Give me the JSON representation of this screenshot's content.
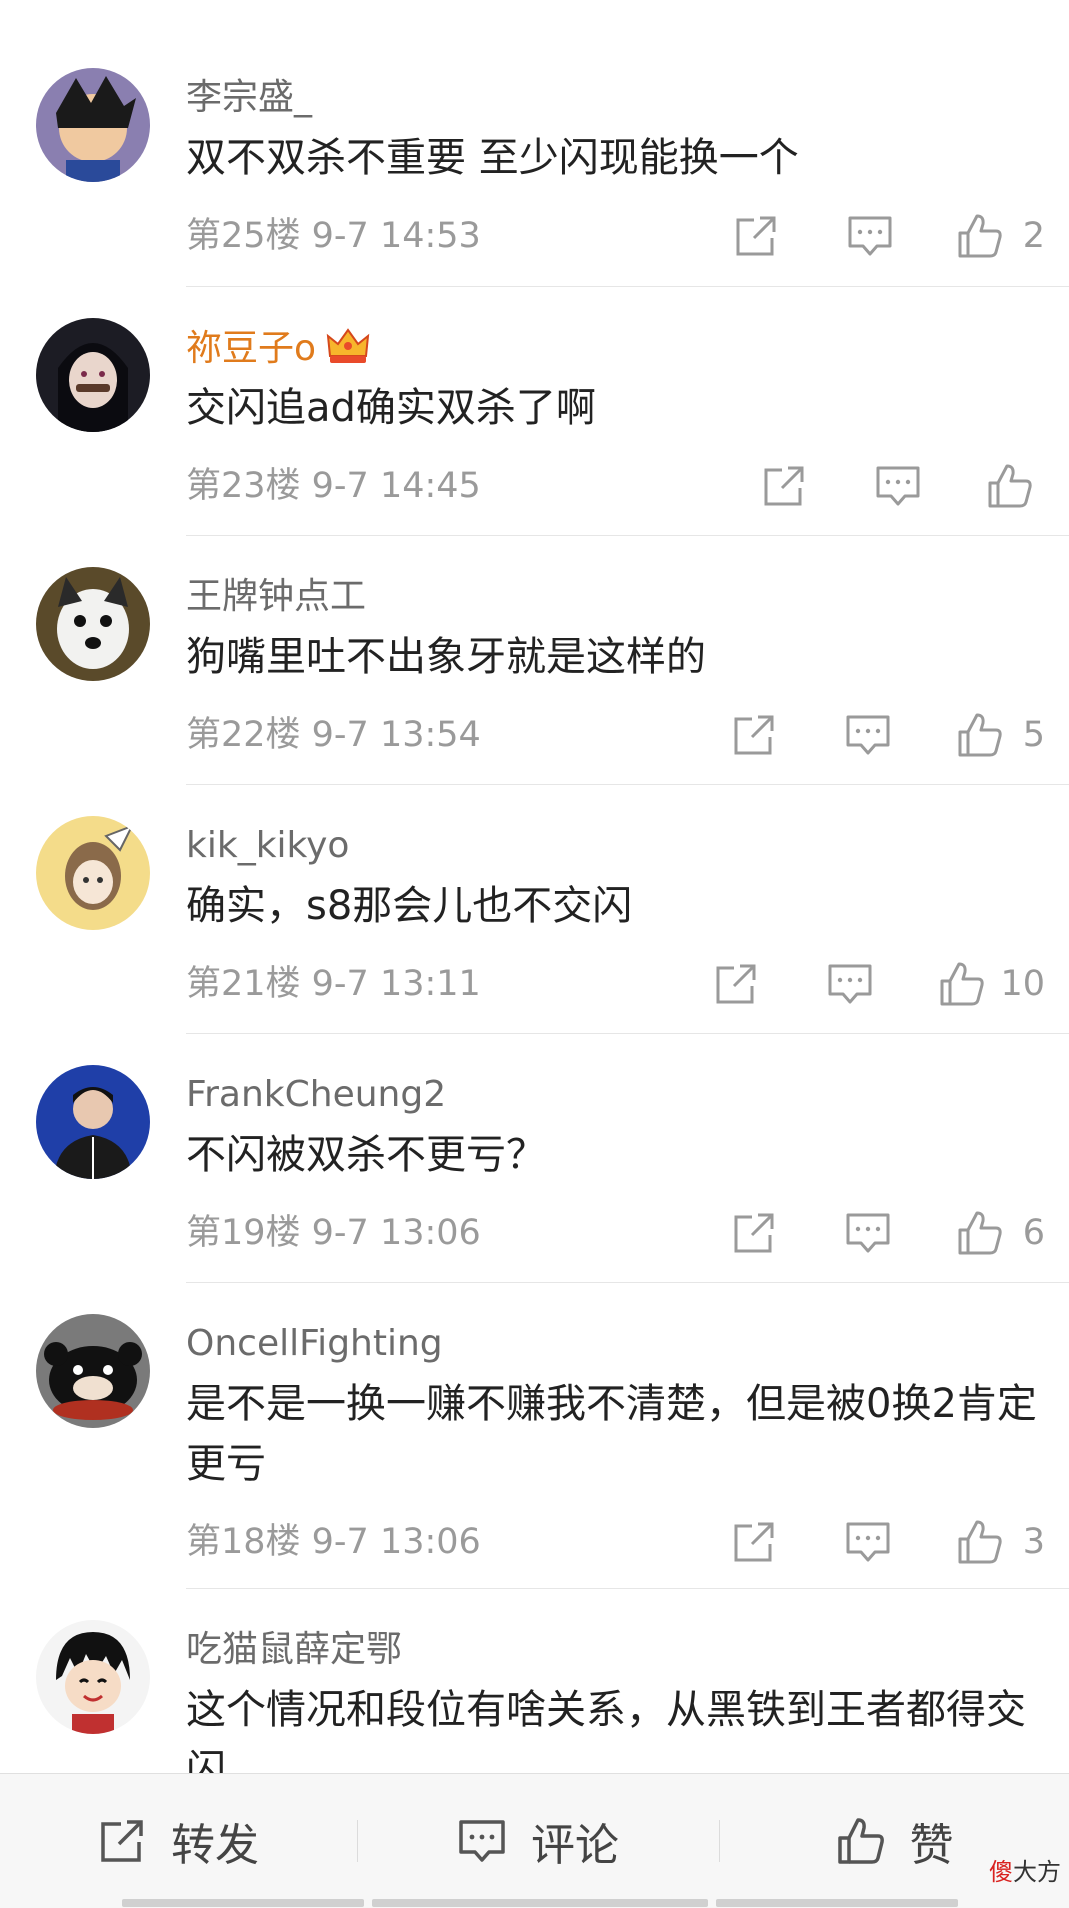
{
  "comments": [
    {
      "user": "李宗盛_",
      "text": "双不双杀不重要  至少闪现能换一个",
      "meta": "第25楼 9-7 14:53",
      "likes": "2"
    },
    {
      "user": "祢豆子o",
      "text": "交闪追ad确实双杀了啊",
      "meta": "第23楼 9-7 14:45",
      "likes": ""
    },
    {
      "user": "王牌钟点工",
      "text": "狗嘴里吐不出象牙就是这样的",
      "meta": "第22楼 9-7 13:54",
      "likes": "5"
    },
    {
      "user": "kik_kikyo",
      "text": "确实，s8那会儿也不交闪",
      "meta": "第21楼 9-7 13:11",
      "likes": "10"
    },
    {
      "user": "FrankCheung2",
      "text": "不闪被双杀不更亏？",
      "meta": "第19楼 9-7 13:06",
      "likes": "6"
    },
    {
      "user": "OncellFighting",
      "text": "是不是一换一赚不赚我不清楚，但是被0换2肯定更亏",
      "meta": "第18楼 9-7 13:06",
      "likes": "3"
    },
    {
      "user": "吃猫鼠薛定鄂",
      "text": "这个情况和段位有啥关系，从黑铁到王者都得交闪",
      "meta": "",
      "likes": ""
    }
  ],
  "bottom_bar": {
    "repost": "转发",
    "comment": "评论",
    "like": "赞"
  },
  "watermark": {
    "red": "傻",
    "rest": "大方"
  },
  "colors": {
    "vip_name": "#e07b1c",
    "meta": "#9a9a9a",
    "text": "#222222"
  }
}
